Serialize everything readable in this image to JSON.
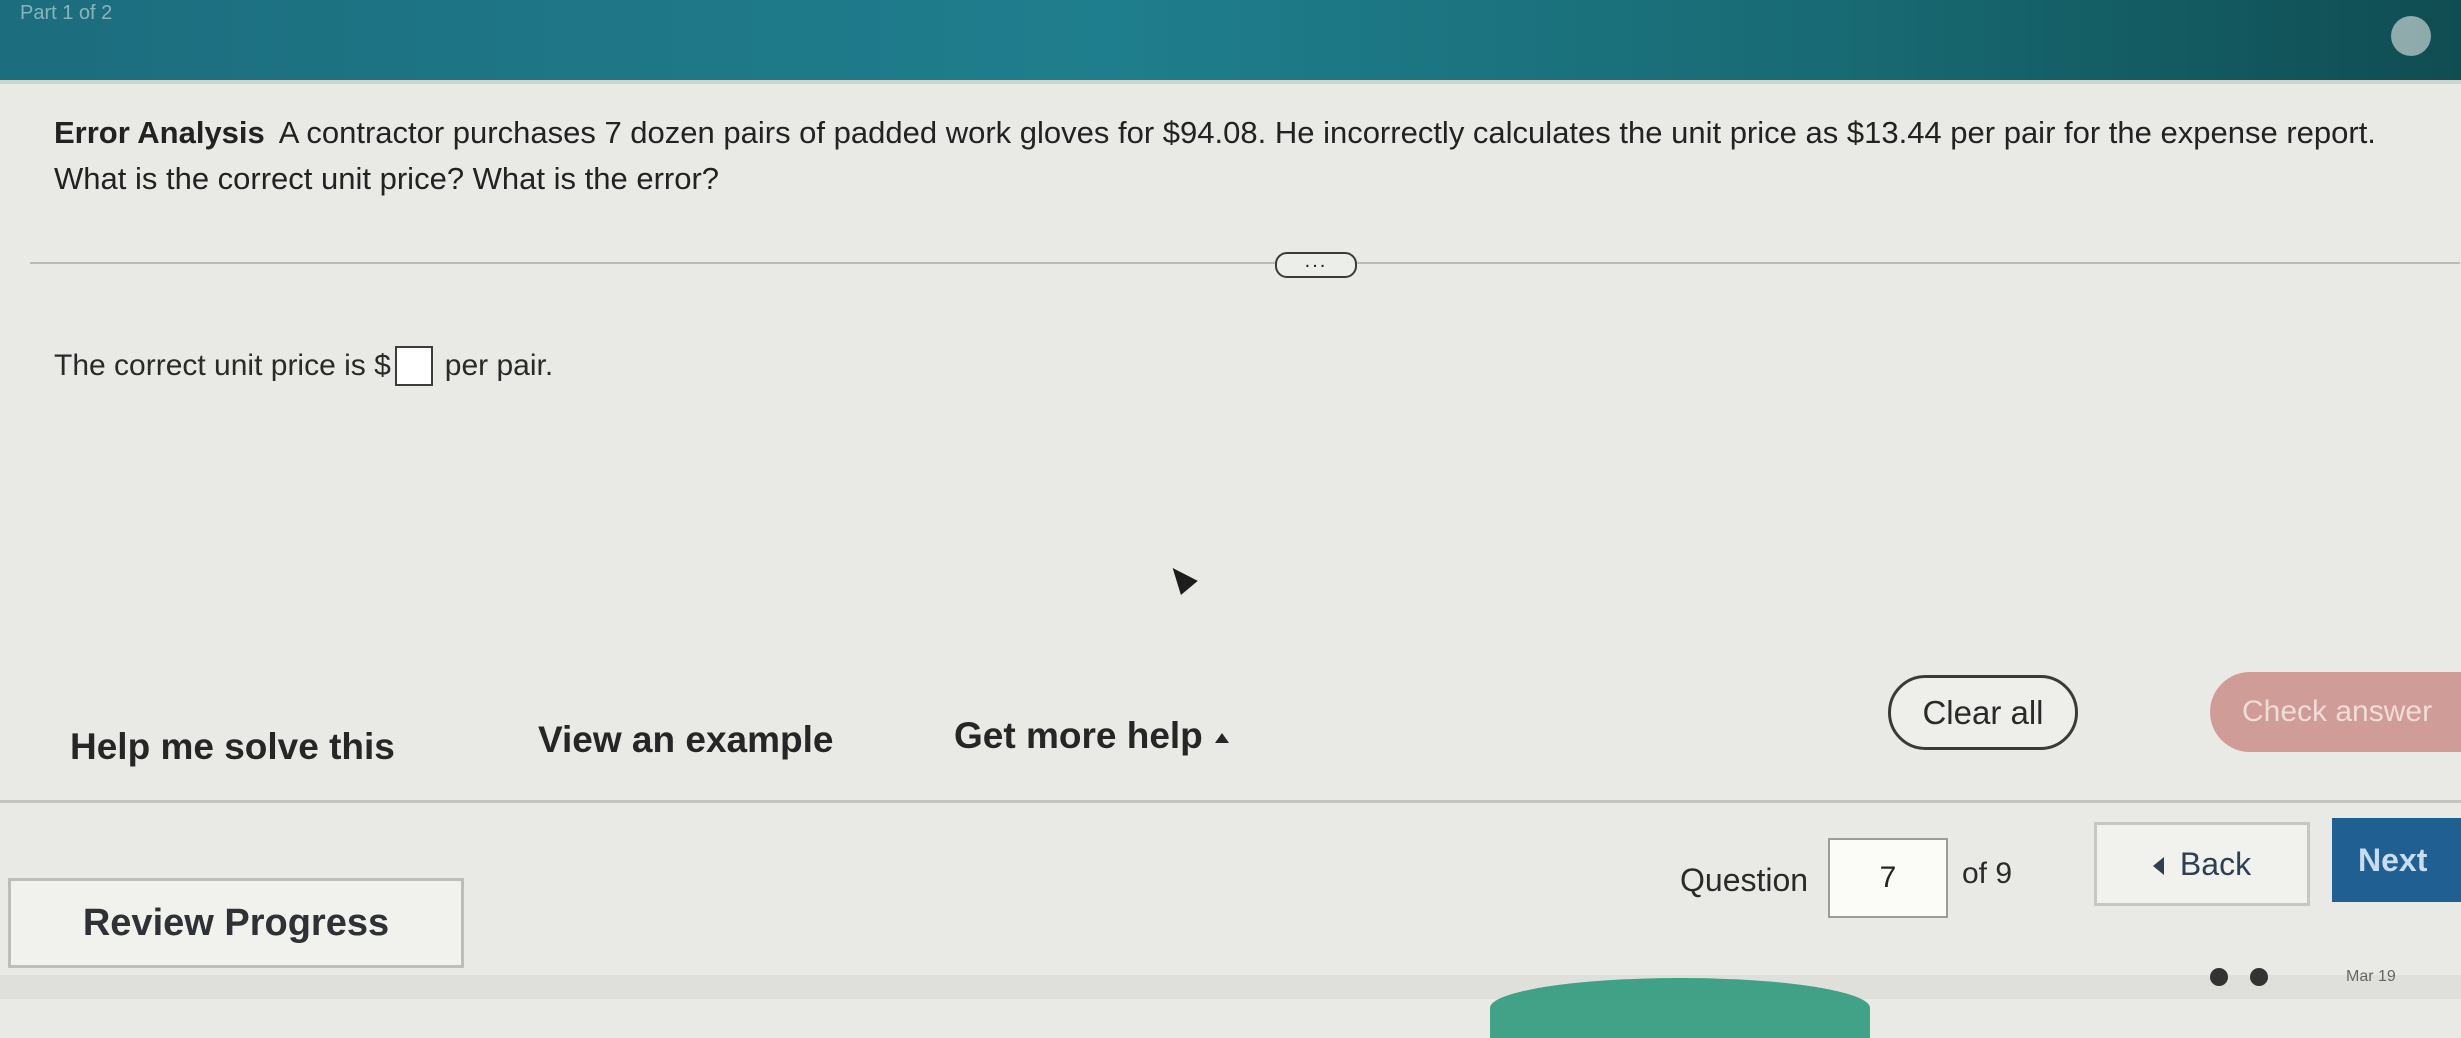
{
  "top_bar": {
    "label": "Part 1 of 2"
  },
  "question": {
    "tag": "Error Analysis",
    "text": "A contractor purchases 7 dozen pairs of padded work gloves for $94.08. He incorrectly calculates the unit price as $13.44 per pair for the expense report. What is the correct unit price? What is the error?"
  },
  "more_indicator": "...",
  "answer": {
    "prefix": "The correct unit price is $",
    "suffix": "per pair.",
    "value": ""
  },
  "help_links": {
    "help_me_solve": "Help me solve this",
    "view_example": "View an example",
    "get_more_help": "Get more help"
  },
  "actions": {
    "clear_all": "Clear all",
    "check_answer": "Check answer"
  },
  "footer": {
    "review_progress": "Review Progress",
    "question_label": "Question",
    "question_number": "7",
    "of_total": "of 9",
    "back": "Back",
    "next": "Next"
  },
  "taskbar": {
    "date": "Mar 19"
  }
}
